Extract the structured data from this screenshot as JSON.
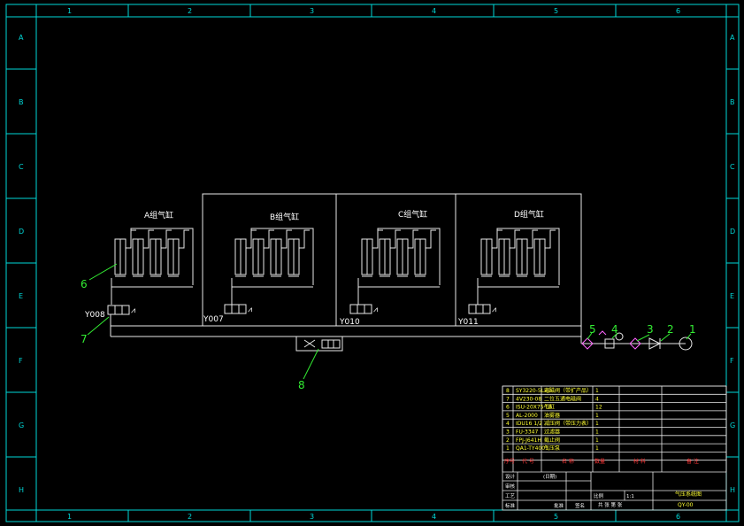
{
  "grid": {
    "columns": [
      "1",
      "2",
      "3",
      "4",
      "5",
      "6"
    ],
    "rows": [
      "A",
      "B",
      "C",
      "D",
      "E",
      "F",
      "G",
      "H"
    ]
  },
  "groups": [
    {
      "label": "A组气缸",
      "valve": "Y008"
    },
    {
      "label": "B组气缸",
      "valve": "Y007"
    },
    {
      "label": "C组气缸",
      "valve": "Y010"
    },
    {
      "label": "D组气缸",
      "valve": "Y011"
    }
  ],
  "callouts": [
    "1",
    "2",
    "3",
    "4",
    "5",
    "6",
    "7",
    "8"
  ],
  "parts_table": {
    "rows": [
      {
        "no": "8",
        "code": "SY3220-5LZD",
        "name": "电磁阀（带扩产品）",
        "qty": "1"
      },
      {
        "no": "7",
        "code": "4V230-08",
        "name": "二位五通电磁阀",
        "qty": "4"
      },
      {
        "no": "6",
        "code": "ISU-20X75-LB",
        "name": "气缸",
        "qty": "12"
      },
      {
        "no": "5",
        "code": "AL-2000",
        "name": "油雾器",
        "qty": "1"
      },
      {
        "no": "4",
        "code": "IDU16 1/2",
        "name": "减压阀（带压力表）",
        "qty": "1"
      },
      {
        "no": "3",
        "code": "FU-3347",
        "name": "过滤器",
        "qty": "1"
      },
      {
        "no": "2",
        "code": "FPJ-J641H",
        "name": "截止阀",
        "qty": "1"
      },
      {
        "no": "1",
        "code": "QA1-TY4001",
        "name": "气压泵",
        "qty": "1"
      }
    ],
    "header": {
      "no": "序号",
      "code": "代  号",
      "name": "名  称",
      "qty": "数量",
      "material": "材  料",
      "remark": "备  注"
    }
  },
  "title_block": {
    "design": "设计",
    "date_mark": "(日期)",
    "check": "审核",
    "craft": "工艺",
    "std": "标准",
    "approve": "批准",
    "scale_label": "比例",
    "scale": "1:1",
    "title": "气压系统图",
    "drawing_no": "QY-00",
    "sheet_info": "共  张  第  张",
    "sign": "签名"
  }
}
